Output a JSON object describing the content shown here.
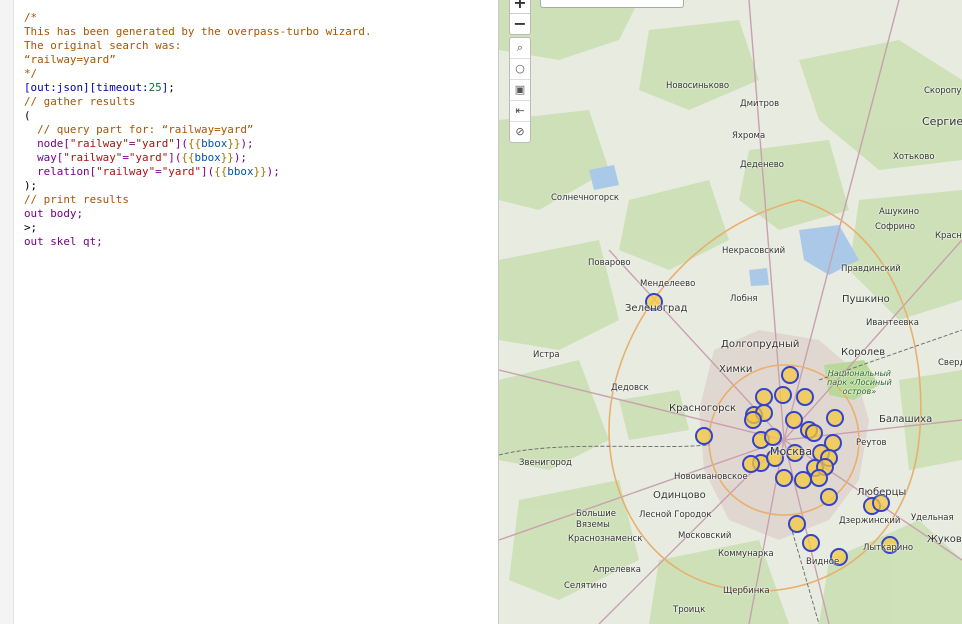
{
  "editor": {
    "lines": [
      "/*",
      "This has been generated by the overpass-turbo wizard.",
      "The original search was:",
      "“railway=yard”",
      "*/",
      "[out:json][timeout:25];",
      "// gather results",
      "(",
      "  // query part for: “railway=yard”",
      "  node[\"railway\"=\"yard\"]({{bbox}});",
      "  way[\"railway\"=\"yard\"]({{bbox}});",
      "  relation[\"railway\"=\"yard\"]({{bbox}});",
      ");",
      "// print results",
      "out body;",
      ">;",
      "out skel qt;"
    ]
  },
  "map": {
    "zoom_in": "+",
    "zoom_out": "−",
    "tools": [
      "⌕",
      "○",
      "▣",
      "⇤",
      "⊘"
    ],
    "marker_color": "#f5c842",
    "marker_stroke": "#3344cc",
    "places": {
      "novosinkovo": "Новосиньково",
      "dmitrov": "Дмитров",
      "skoropu": "Скоропу",
      "yakhroma": "Яхрома",
      "sergiev": "Сергие",
      "dedenevo": "Деденево",
      "khotkovo": "Хотьково",
      "solnechnogorsk": "Солнечногорск",
      "ashukino": "Ашукино",
      "sofrino": "Софрино",
      "nekrasovsky": "Некрасовский",
      "krasno": "Красно",
      "povarovo": "Поварово",
      "pravdinsky": "Правдинский",
      "mendeleevo": "Менделеево",
      "lobnya": "Лобня",
      "pushkino": "Пушкино",
      "zelenograd": "Зеленоград",
      "ivanteevka": "Ивантеевка",
      "dolgoprudny": "Долгопрудный",
      "korolev": "Королев",
      "istra": "Истра",
      "khimki": "Химки",
      "sverd": "Свердл",
      "park": "Национальный\nпарк «Лосиный\nостров»",
      "dedovsk": "Дедовск",
      "krasnogorsk": "Красногорск",
      "balashikha": "Балашиха",
      "moskva": "Москва",
      "reutov": "Реутов",
      "zvenigorod": "Звенигород",
      "novoivanovskoe": "Новоивановское",
      "odintsovo": "Одинцово",
      "lyubertsy": "Люберцы",
      "bolshie_vyazemy": "Большие\nВяземы",
      "lesnoy_gorodok": "Лесной Городок",
      "dzerzhinsky": "Дзержинский",
      "udelnaya": "Удельная",
      "krasnoznamensk": "Краснознаменск",
      "moskovsky": "Московский",
      "zhukovo": "Жуково",
      "kommunarka": "Коммунарка",
      "lytkarino": "Лыткарино",
      "vidnoe": "Видное",
      "aprelevka": "Апрелевка",
      "selyatino": "Селятино",
      "shcherbinka": "Щербинка",
      "troitsk": "Троицк"
    }
  }
}
